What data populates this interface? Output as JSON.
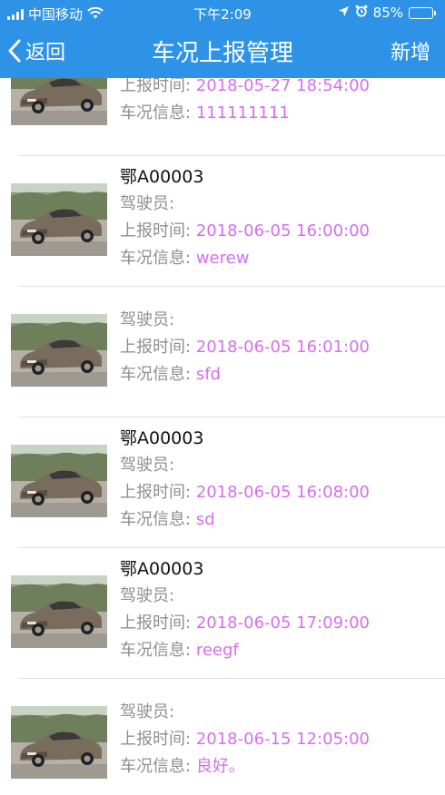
{
  "status_bar": {
    "carrier": "中国移动",
    "time": "下午2:09",
    "battery_pct": "85%",
    "battery_level": 0.85
  },
  "nav": {
    "back_label": "返回",
    "title": "车况上报管理",
    "action_label": "新增"
  },
  "labels": {
    "driver": "驾驶员:",
    "report_time": "上报时间:",
    "car_info": "车况信息:"
  },
  "reports": [
    {
      "plate": "",
      "report_time": "2018-05-27 18:54:00",
      "car_info": "111111111"
    },
    {
      "plate": "鄂A00003",
      "report_time": "2018-06-05 16:00:00",
      "car_info": "werew"
    },
    {
      "plate": "",
      "report_time": "2018-06-05 16:01:00",
      "car_info": "sfd"
    },
    {
      "plate": "鄂A00003",
      "report_time": "2018-06-05 16:08:00",
      "car_info": "sd"
    },
    {
      "plate": "鄂A00003",
      "report_time": "2018-06-05 17:09:00",
      "car_info": "reegf"
    },
    {
      "plate": "",
      "report_time": "2018-06-15 12:05:00",
      "car_info": "良好。"
    }
  ],
  "colors": {
    "header_bg": "#2e93e6",
    "value_text": "#d76df0",
    "label_text": "#8f8f8f"
  }
}
